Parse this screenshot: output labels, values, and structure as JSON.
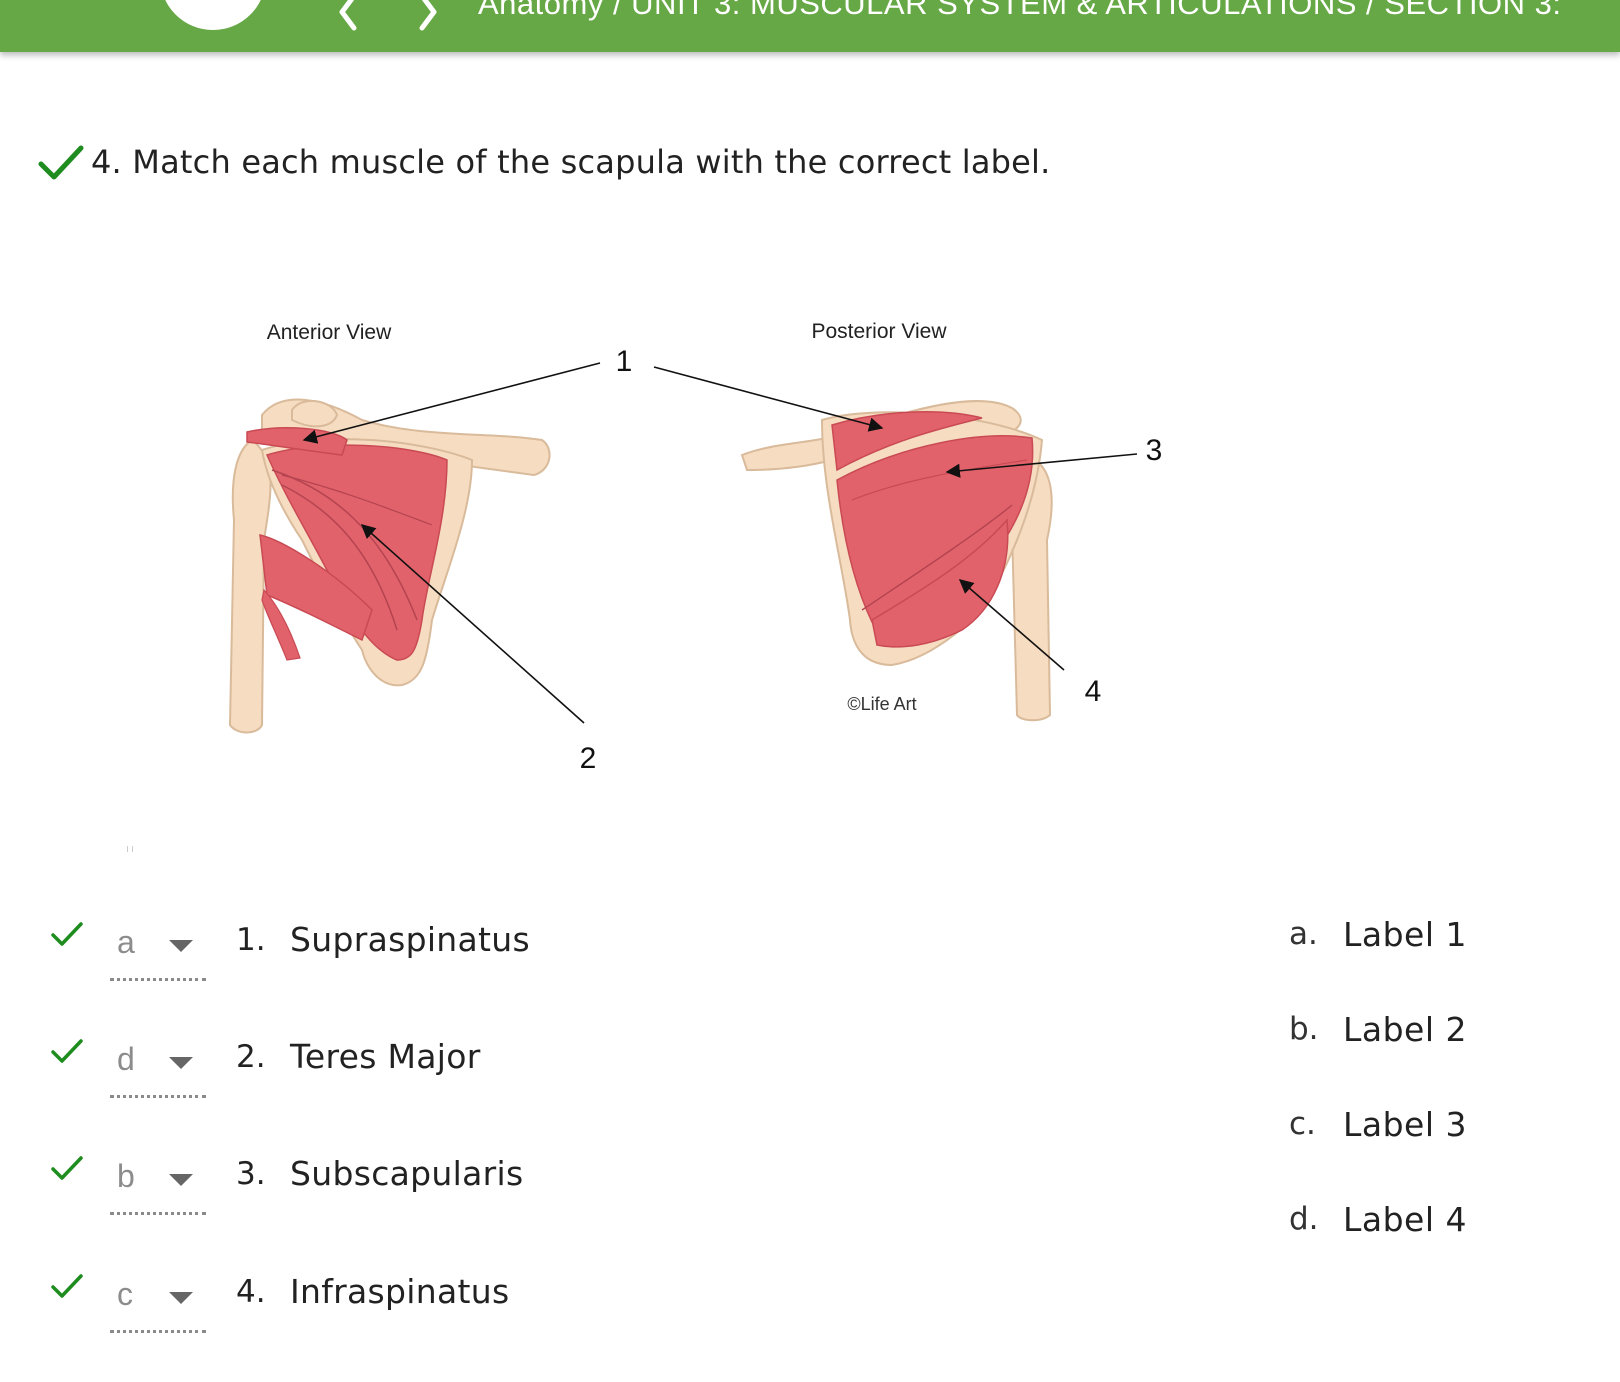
{
  "header": {
    "breadcrumb": "Anatomy / UNIT 3: MUSCULAR SYSTEM & ARTICULATIONS / SECTION 3:",
    "menu_icon": "menu-icon",
    "prev_icon": "chevron-left-icon",
    "next_icon": "chevron-right-icon",
    "brand_color": "#66a845"
  },
  "question": {
    "text": "4. Match each muscle of the scapula with the correct label.",
    "status_icon": "checkmark-icon",
    "status_color": "#1e8c1e"
  },
  "figure": {
    "anterior_title": "Anterior View",
    "posterior_title": "Posterior View",
    "copyright": "©Life Art",
    "callouts": [
      "1",
      "2",
      "3",
      "4"
    ]
  },
  "matches": [
    {
      "selected": "a",
      "number": "1.",
      "term": "Supraspinatus"
    },
    {
      "selected": "d",
      "number": "2.",
      "term": "Teres Major"
    },
    {
      "selected": "b",
      "number": "3.",
      "term": "Subscapularis"
    },
    {
      "selected": "c",
      "number": "4.",
      "term": "Infraspinatus"
    }
  ],
  "answers": [
    {
      "letter": "a.",
      "text": "Label 1"
    },
    {
      "letter": "b.",
      "text": "Label 2"
    },
    {
      "letter": "c.",
      "text": "Label 3"
    },
    {
      "letter": "d.",
      "text": "Label 4"
    }
  ]
}
